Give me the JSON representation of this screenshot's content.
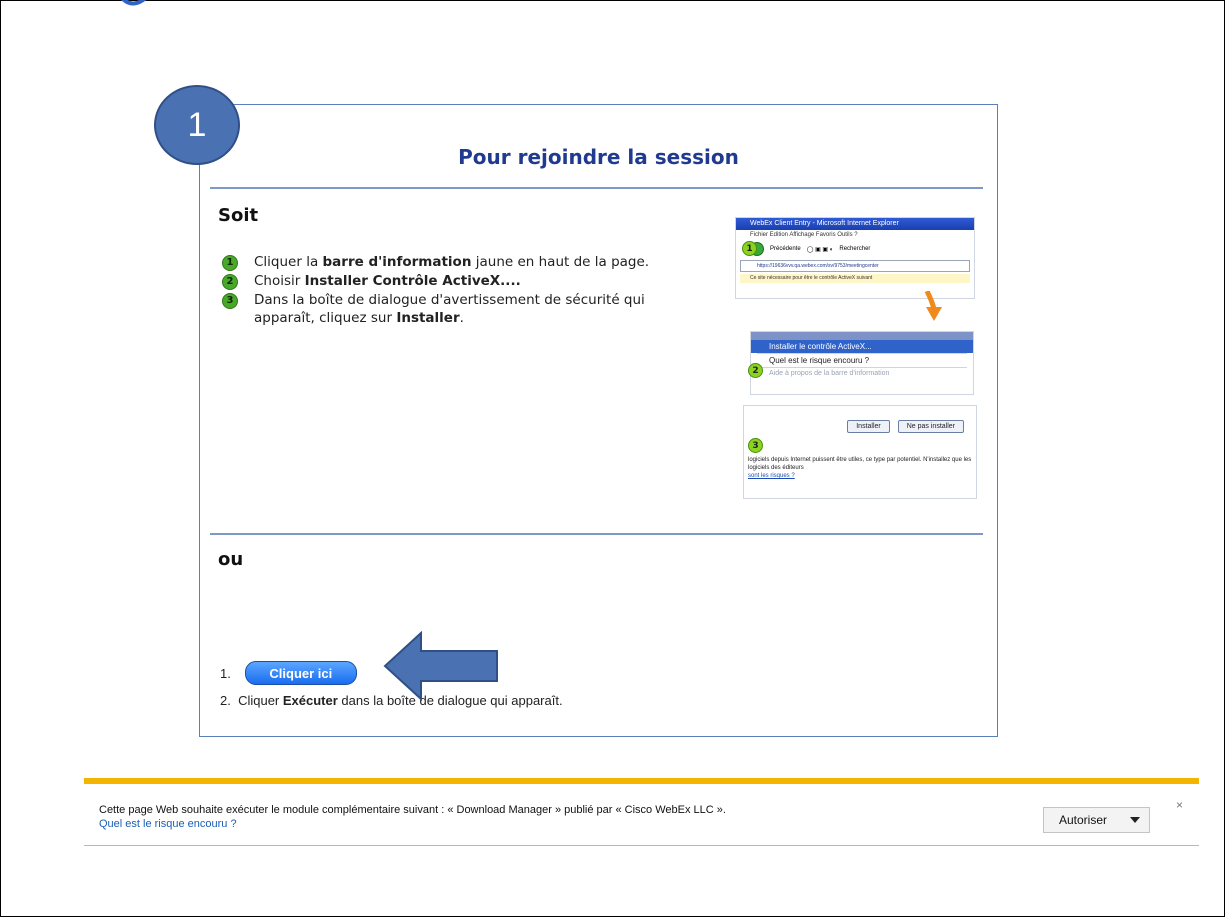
{
  "step_badge": "1",
  "panel": {
    "title": "Pour rejoindre la session",
    "soit_heading": "Soit",
    "ou_heading": "ou",
    "steps": [
      {
        "num": "1",
        "pre": "Cliquer la ",
        "bold": "barre d'information",
        "post": " jaune en haut de la page."
      },
      {
        "num": "2",
        "pre": "Choisir ",
        "bold": "Installer Contrôle ActiveX....",
        "post": ""
      },
      {
        "num": "3",
        "pre": "Dans la boîte de dialogue d'avertissement de sécurité qui apparaît, cliquez sur ",
        "bold": "Installer",
        "post": "."
      }
    ],
    "screenshot1": {
      "title": "WebEx Client Entry - Microsoft Internet Explorer",
      "menu": "Fichier   Edition   Affichage   Favoris   Outils   ?",
      "toolbar_back": "Précédente",
      "toolbar_search": "Rechercher",
      "address": "https://19636vvv.qa.webex.com/sv/9753/meetingcenter",
      "infobar": "Ce site nécessaire pour être le contrôle ActiveX suivant"
    },
    "screenshot2": {
      "item_selected": "Installer le contrôle ActiveX...",
      "item_risk": "Quel est le risque encouru ?",
      "item_faded": "Aide à propos de la barre d'information"
    },
    "screenshot3": {
      "btn_install": "Installer",
      "btn_noinstall": "Ne pas installer",
      "text": "logiciels depuis Internet puissent être utiles, ce type par potentiel. N'installez que les logiciels des éditeurs",
      "link": "sont les risques ?"
    },
    "option2": {
      "num1": "1.",
      "button": "Cliquer ici",
      "num2": "2.",
      "line2_pre": "Cliquer ",
      "line2_bold": "Exécuter",
      "line2_post": " dans la boîte de dialogue qui apparaît."
    }
  },
  "notification": {
    "message": "Cette page Web souhaite exécuter le module complémentaire suivant : « Download Manager » publié par « Cisco WebEx LLC ».",
    "link": "Quel est le risque encouru ?",
    "allow_button": "Autoriser",
    "close": "×"
  },
  "colors": {
    "title_blue": "#1f3a8f",
    "badge_blue": "#4a72b2",
    "notif_orange": "#f3b500",
    "step_green": "#49a82a"
  },
  "icons": [
    "step-number-icon",
    "orange-down-arrow-icon",
    "blue-left-arrow-icon",
    "dropdown-chevron-icon",
    "close-icon"
  ]
}
